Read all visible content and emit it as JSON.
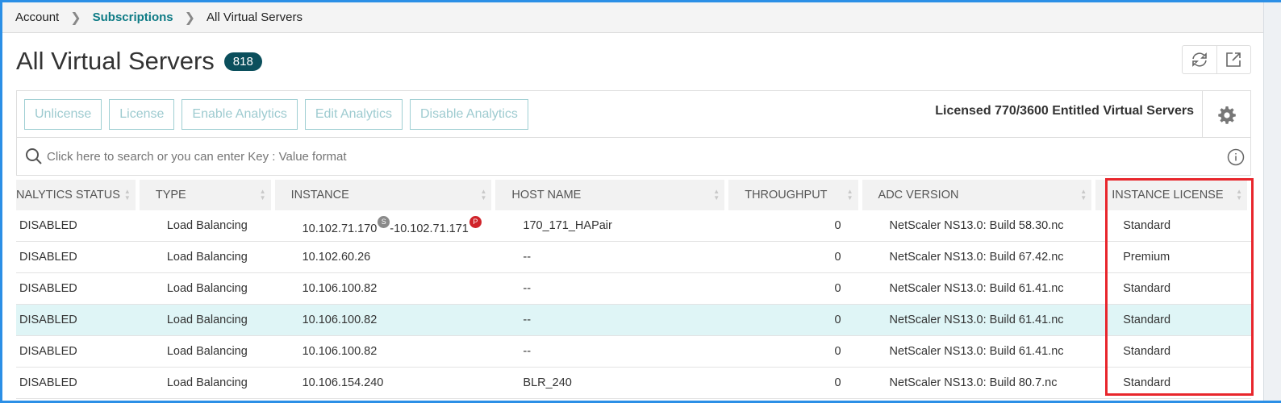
{
  "breadcrumb": {
    "items": [
      {
        "label": "Account"
      },
      {
        "label": "Subscriptions"
      },
      {
        "label": "All Virtual Servers"
      }
    ]
  },
  "page": {
    "title": "All Virtual Servers",
    "count": "818"
  },
  "toolbar": {
    "buttons": [
      "Unlicense",
      "License",
      "Enable Analytics",
      "Edit Analytics",
      "Disable Analytics"
    ],
    "license_summary": "Licensed 770/3600 Entitled Virtual Servers"
  },
  "search": {
    "placeholder": "Click here to search or you can enter Key : Value format"
  },
  "table": {
    "columns": [
      "NALYTICS STATUS",
      "TYPE",
      "INSTANCE",
      "HOST NAME",
      "THROUGHPUT",
      "ADC VERSION",
      "INSTANCE LICENSE"
    ],
    "rows": [
      {
        "status": "DISABLED",
        "type": "Load Balancing",
        "instance": "10.102.71.170",
        "tag1": "S",
        "instance2": "-10.102.71.171",
        "tag2": "P",
        "host": "170_171_HAPair",
        "throughput": "0",
        "version": "NetScaler NS13.0: Build 58.30.nc",
        "license": "Standard"
      },
      {
        "status": "DISABLED",
        "type": "Load Balancing",
        "instance": "10.102.60.26",
        "host": "--",
        "throughput": "0",
        "version": "NetScaler NS13.0: Build 67.42.nc",
        "license": "Premium"
      },
      {
        "status": "DISABLED",
        "type": "Load Balancing",
        "instance": "10.106.100.82",
        "host": "--",
        "throughput": "0",
        "version": "NetScaler NS13.0: Build 61.41.nc",
        "license": "Standard"
      },
      {
        "status": "DISABLED",
        "type": "Load Balancing",
        "instance": "10.106.100.82",
        "host": "--",
        "throughput": "0",
        "version": "NetScaler NS13.0: Build 61.41.nc",
        "license": "Standard"
      },
      {
        "status": "DISABLED",
        "type": "Load Balancing",
        "instance": "10.106.100.82",
        "host": "--",
        "throughput": "0",
        "version": "NetScaler NS13.0: Build 61.41.nc",
        "license": "Standard"
      },
      {
        "status": "DISABLED",
        "type": "Load Balancing",
        "instance": "10.106.154.240",
        "host": "BLR_240",
        "throughput": "0",
        "version": "NetScaler NS13.0: Build 80.7.nc",
        "license": "Standard"
      }
    ],
    "highlighted_row": 4
  },
  "colors": {
    "accent": "#0e7b85",
    "badge": "#0b4f5c",
    "highlight_row": "#dff5f6",
    "annotation_box": "#e8262c",
    "tag_secondary": "#8a8a8a",
    "tag_primary": "#d0232a"
  },
  "icons": [
    "chevron-right-icon",
    "refresh-icon",
    "external-link-icon",
    "gear-icon",
    "search-icon",
    "info-icon",
    "sort-icon"
  ]
}
